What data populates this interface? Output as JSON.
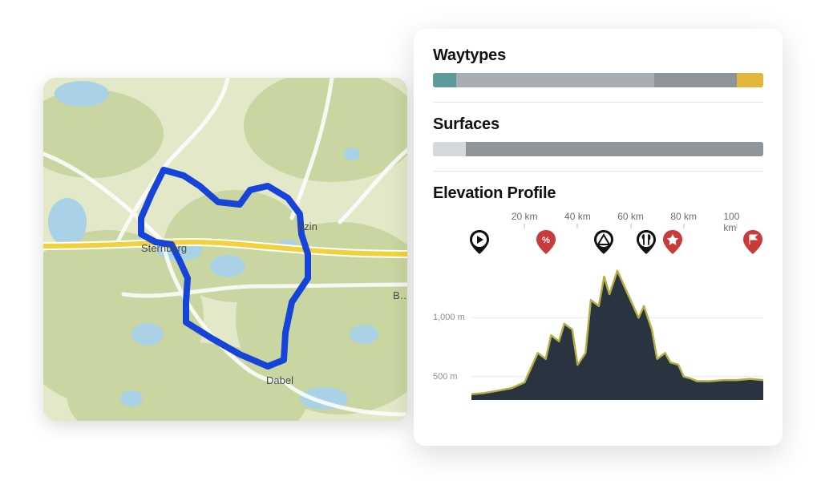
{
  "map": {
    "labels": {
      "sternberg": "Sternberg",
      "dabel": "Dabel",
      "itzin": "Itzin",
      "top_partial": "…",
      "right_partial": "B…"
    },
    "route_color": "#1643d8"
  },
  "panels": {
    "waytypes": {
      "title": "Waytypes"
    },
    "surfaces": {
      "title": "Surfaces"
    },
    "elevation": {
      "title": "Elevation Profile"
    }
  },
  "chart_data": [
    {
      "type": "bar",
      "id": "waytypes",
      "title": "Waytypes",
      "series": [
        {
          "name": "teal",
          "percent": 7,
          "color": "#5c9b99"
        },
        {
          "name": "grey1",
          "percent": 60,
          "color": "#a7aeb3"
        },
        {
          "name": "grey2",
          "percent": 25,
          "color": "#8e969c"
        },
        {
          "name": "yellow",
          "percent": 8,
          "color": "#e4b63e"
        }
      ]
    },
    {
      "type": "bar",
      "id": "surfaces",
      "title": "Surfaces",
      "series": [
        {
          "name": "light",
          "percent": 10,
          "color": "#d6d9dc"
        },
        {
          "name": "dark",
          "percent": 90,
          "color": "#8e969c"
        }
      ]
    },
    {
      "type": "area",
      "id": "elevation",
      "title": "Elevation Profile",
      "xlabel": "",
      "ylabel": "",
      "x_unit": "km",
      "y_unit": "m",
      "x_ticks": [
        20,
        40,
        60,
        80,
        100
      ],
      "x_tick_labels": [
        "20 km",
        "40 km",
        "60 km",
        "80 km",
        "100 km"
      ],
      "y_ticks": [
        500,
        1000
      ],
      "y_tick_labels": [
        "500 m",
        "1,000 m"
      ],
      "xlim": [
        0,
        110
      ],
      "ylim": [
        300,
        1500
      ],
      "x": [
        0,
        5,
        10,
        15,
        20,
        25,
        28,
        30,
        33,
        35,
        38,
        40,
        43,
        45,
        48,
        50,
        52,
        55,
        58,
        60,
        63,
        65,
        68,
        70,
        73,
        75,
        78,
        80,
        83,
        85,
        90,
        95,
        100,
        105,
        110
      ],
      "elevation": [
        350,
        360,
        380,
        400,
        450,
        700,
        650,
        850,
        800,
        950,
        900,
        600,
        700,
        1150,
        1100,
        1350,
        1200,
        1400,
        1250,
        1150,
        1000,
        1100,
        900,
        650,
        700,
        620,
        600,
        500,
        480,
        460,
        460,
        470,
        470,
        480,
        470
      ],
      "fill_color": "#2a3441",
      "stroke_color": "#a7c24b",
      "pois": [
        {
          "kind": "start",
          "icon": "play",
          "x_km": 3,
          "color": "#111111"
        },
        {
          "kind": "grade",
          "icon": "percent",
          "x_km": 28,
          "color": "#c93a3a"
        },
        {
          "kind": "camp",
          "icon": "tent",
          "x_km": 50,
          "color": "#111111"
        },
        {
          "kind": "food",
          "icon": "cutlery",
          "x_km": 66,
          "color": "#111111"
        },
        {
          "kind": "star",
          "icon": "star",
          "x_km": 76,
          "color": "#c93a3a"
        },
        {
          "kind": "flag",
          "icon": "flag",
          "x_km": 106,
          "color": "#c93a3a"
        }
      ]
    }
  ]
}
